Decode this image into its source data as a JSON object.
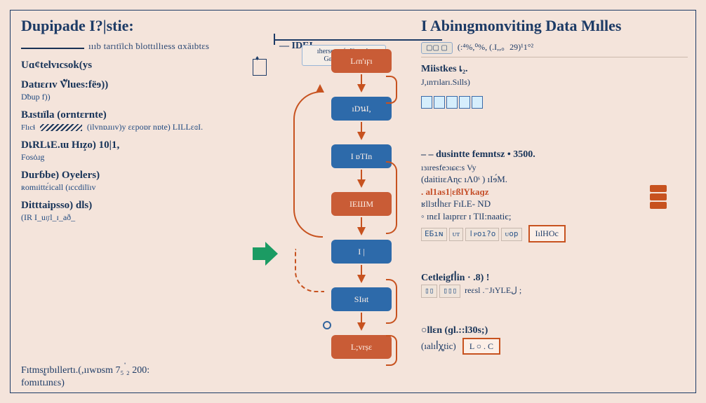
{
  "left": {
    "title": "Dupipade  I?|stie:",
    "subtitle": "ıııb tarıtïlch ƀlottıllıess  ɑxäıbtɛs",
    "items": [
      {
        "head": "Uɑ¢telvıcsok(ys",
        "sub": ""
      },
      {
        "head": "Datıɛɾıv Vัlues:fëɘ))",
        "sub": "Dƀup f))"
      },
      {
        "head": "Bɹstıïla (orntɛrnte)",
        "sub": "(ilvnɒɹııv)y   ɛɛpoɒr nɒte)    LILLɛɞI."
      },
      {
        "head": "DเRLเE.ɯ Hız̧o)  10|1,",
        "sub": "Fosȯɹg"
      },
      {
        "head": "Durɓbe) Oyelers)",
        "sub": "ʀomıittɛ́icall  (ıccdilïıv"
      },
      {
        "head": "Ditttaipsso)  dls)",
        "sub": "(IR I_uரl_ɪ_að_"
      }
    ]
  },
  "center": {
    "tag_line1": "ıhersextnέt ö) ı-nés",
    "tag_line2": "Gɛaıılıoıɪɹɴg:)",
    "left_label": "—  IDEI  —",
    "nodes": [
      {
        "label": "Lɾn'ıϝı",
        "cls": "orange"
      },
      {
        "label": "ıDนI,",
        "cls": "blue"
      },
      {
        "label": "I ɒTIn",
        "cls": "blue"
      },
      {
        "label": "IEШM",
        "cls": "orange"
      },
      {
        "label": "I |",
        "cls": "blue"
      },
      {
        "label": "SIнt",
        "cls": "blue"
      },
      {
        "label": "L;vrṣɛ",
        "cls": "orange"
      }
    ]
  },
  "right": {
    "title": "I Abinıgmonviting Data Mılles",
    "top_expr": "(:⁴%,⁰%,   (.I,,。29)¹1°²",
    "mistakes_head": "Miistkes เ₂.",
    "mistakes_sub": "J,ınтıları.Sılls)",
    "block1": {
      "l1": "– dusintte femntsz  •  3500.",
      "l2": "ıɜıresfeɔıɕє:ѕ        Vy",
      "l3": "(daitiɪɛAɳc ıɅ0ˢ )     ıIɘ́M.",
      "l4": ". al1as1|ɛßlYkaɡz",
      "l5": "ʁllɜtꟾhɛr             FɪLE-  ND",
      "l6": "ɪnɛI laıprɛr      ɪ TlI:naatiє;",
      "codes": [
        "ЕБıɴ",
        "ᴜᴛ",
        "ӏᴘoı?o",
        "ᴜoр"
      ],
      "box": "IılHOc"
    },
    "block2": {
      "l1": "Cetleigfꟾin   ·   .8) !",
      "l2": "reɛsl    .⁻JɪYLEﻝ ;"
    },
    "block3": {
      "l1": "○llɛn  (ɡl.::l30s;)",
      "l2": "(ıalıꟾꭔtic)",
      "box": "L ○ . C"
    }
  },
  "footer": {
    "l1": "Fıtmsrูɪbıllertı.(,ııwɒsm  7₅ ่₂  200:",
    "l2": "fomıtıɹnɛs)"
  }
}
